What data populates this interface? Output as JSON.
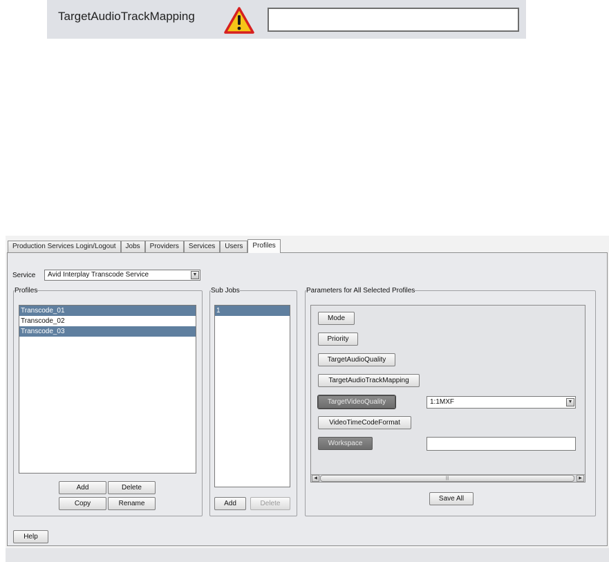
{
  "callout": {
    "label": "TargetAudioTrackMapping",
    "warning_icon": "warning-triangle-icon",
    "input_value": ""
  },
  "tabs": [
    {
      "label": "Production Services Login/Logout",
      "active": false
    },
    {
      "label": "Jobs",
      "active": false
    },
    {
      "label": "Providers",
      "active": false
    },
    {
      "label": "Services",
      "active": false
    },
    {
      "label": "Users",
      "active": false
    },
    {
      "label": "Profiles",
      "active": true
    }
  ],
  "service": {
    "label": "Service",
    "selected": "Avid Interplay Transcode Service"
  },
  "profiles": {
    "legend": "Profiles",
    "items": [
      {
        "label": "Transcode_01",
        "selected": true
      },
      {
        "label": "Transcode_02",
        "selected": false
      },
      {
        "label": "Transcode_03",
        "selected": true
      }
    ],
    "buttons": {
      "add": "Add",
      "delete": "Delete",
      "copy": "Copy",
      "rename": "Rename"
    }
  },
  "subjobs": {
    "legend": "Sub Jobs",
    "items": [
      {
        "label": "1",
        "selected": true
      }
    ],
    "buttons": {
      "add": "Add",
      "delete": "Delete"
    }
  },
  "parameters": {
    "legend": "Parameters for All Selected Profiles",
    "buttons": {
      "mode": "Mode",
      "priority": "Priority",
      "target_audio_quality": "TargetAudioQuality",
      "target_audio_track_mapping": "TargetAudioTrackMapping",
      "target_video_quality": "TargetVideoQuality",
      "video_timecode_format": "VideoTimeCodeFormat",
      "workspace": "Workspace"
    },
    "target_video_quality_value": "1:1MXF",
    "workspace_value": "",
    "save_all": "Save All"
  },
  "help": "Help",
  "colors": {
    "selection": "#5f7f9f",
    "warning_fill": "#f5c518",
    "warning_stroke": "#d62020"
  }
}
